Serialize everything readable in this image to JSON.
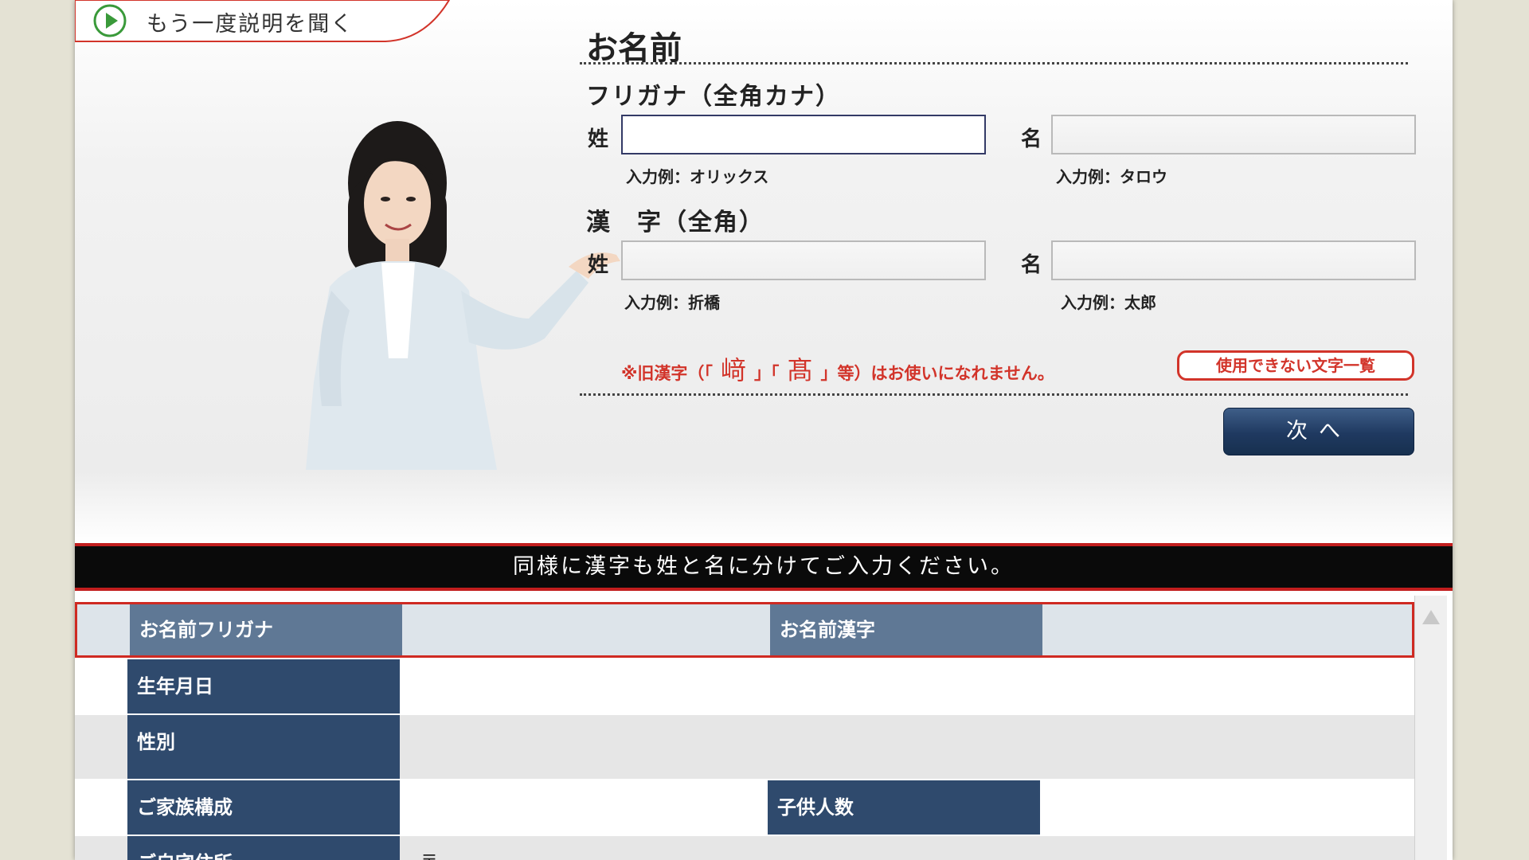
{
  "replay": {
    "label": "もう一度説明を聞く"
  },
  "form": {
    "title": "お名前",
    "furigana": {
      "section_title": "フリガナ（全角カナ）",
      "sei_label": "姓",
      "mei_label": "名",
      "sei_value": "",
      "mei_value": "",
      "sei_hint": "入力例：オリックス",
      "mei_hint": "入力例：タロウ"
    },
    "kanji": {
      "section_title": "漢　字（全角）",
      "sei_label": "姓",
      "mei_label": "名",
      "sei_value": "",
      "mei_value": "",
      "sei_hint": "入力例：折橋",
      "mei_hint": "入力例：太郎"
    },
    "warning": {
      "prefix": "※旧漢字（「",
      "char1": "﨑",
      "mid": "」「",
      "char2": "髙",
      "suffix": "」等）はお使いになれません。"
    },
    "unusable_chars_button": "使用できない文字一覧",
    "next_button": "次へ"
  },
  "caption": "同様に漢字も姓と名に分けてご入力ください。",
  "summary": {
    "rows": [
      {
        "label": "お名前フリガナ",
        "value": "",
        "label2": "お名前漢字",
        "value2": ""
      },
      {
        "label": "生年月日",
        "value": ""
      },
      {
        "label": "性別",
        "value": ""
      },
      {
        "label": "ご家族構成",
        "value": "",
        "label2": "子供人数",
        "value2": ""
      },
      {
        "label": "ご自宅住所",
        "value": "〒"
      }
    ]
  },
  "colors": {
    "accent_red": "#d2342a",
    "navy": "#2f4a6d",
    "replay_green": "#3a9a3a"
  },
  "icons": {
    "replay": "play-circle-icon",
    "scroll_up": "triangle-up-icon"
  }
}
